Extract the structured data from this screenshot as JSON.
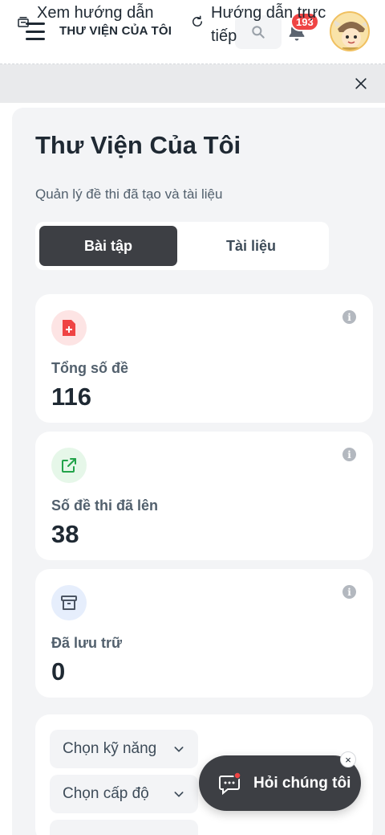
{
  "header": {
    "title": "THƯ VIỆN CỦA TÔI",
    "notification_count": "193"
  },
  "guide": {
    "left_label": "Xem hướng dẫn",
    "right_label": "Hướng dẫn trực tiếp"
  },
  "page": {
    "title": "Thư Viện Của Tôi",
    "subtitle": "Quản lý đề thi đã tạo và tài liệu"
  },
  "tabs": [
    {
      "label": "Bài tập",
      "active": true
    },
    {
      "label": "Tài liệu",
      "active": false
    }
  ],
  "stats": [
    {
      "label": "Tổng số đề",
      "value": "116",
      "icon": "document-plus-icon",
      "color": "#ef4444"
    },
    {
      "label": "Số đề thi đã lên",
      "value": "38",
      "icon": "share-icon",
      "color": "#22c55e"
    },
    {
      "label": "Đã lưu trữ",
      "value": "0",
      "icon": "archive-icon",
      "color": "#3b82f6"
    }
  ],
  "filters": [
    {
      "label": "Chọn kỹ năng"
    },
    {
      "label": "Chọn cấp độ"
    }
  ],
  "chat": {
    "label": "Hỏi chúng tôi",
    "close": "×"
  },
  "info_glyph": "i"
}
